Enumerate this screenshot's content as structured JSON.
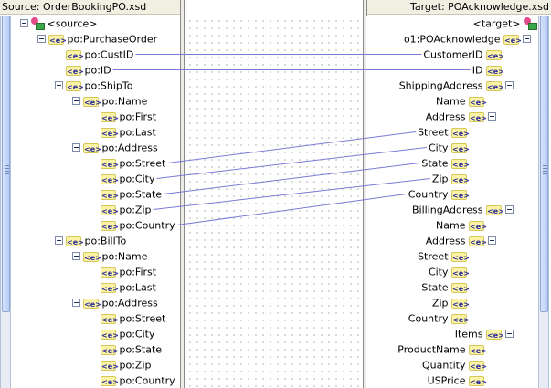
{
  "source_header": "Source: OrderBookingPO.xsd",
  "target_header": "Target: POAcknowledge.xsd",
  "icons": {
    "element": "element-icon",
    "root": "schema-root-icon",
    "expand": "collapse-toggle-icon"
  },
  "element_icon_glyph": "<e>",
  "source_tree": [
    {
      "label": "<source>",
      "level": 0,
      "root": true
    },
    {
      "label": "po:PurchaseOrder",
      "level": 1
    },
    {
      "label": "po:CustID",
      "level": 2
    },
    {
      "label": "po:ID",
      "level": 2
    },
    {
      "label": "po:ShipTo",
      "level": 2
    },
    {
      "label": "po:Name",
      "level": 3
    },
    {
      "label": "po:First",
      "level": 4
    },
    {
      "label": "po:Last",
      "level": 4
    },
    {
      "label": "po:Address",
      "level": 3
    },
    {
      "label": "po:Street",
      "level": 4
    },
    {
      "label": "po:City",
      "level": 4
    },
    {
      "label": "po:State",
      "level": 4
    },
    {
      "label": "po:Zip",
      "level": 4
    },
    {
      "label": "po:Country",
      "level": 4
    },
    {
      "label": "po:BillTo",
      "level": 2
    },
    {
      "label": "po:Name",
      "level": 3
    },
    {
      "label": "po:First",
      "level": 4
    },
    {
      "label": "po:Last",
      "level": 4
    },
    {
      "label": "po:Address",
      "level": 3
    },
    {
      "label": "po:Street",
      "level": 4
    },
    {
      "label": "po:City",
      "level": 4
    },
    {
      "label": "po:State",
      "level": 4
    },
    {
      "label": "po:Zip",
      "level": 4
    },
    {
      "label": "po:Country",
      "level": 4
    }
  ],
  "target_tree": [
    {
      "label": "<target>",
      "level": 0,
      "root": true
    },
    {
      "label": "o1:POAcknowledge",
      "level": 1
    },
    {
      "label": "CustomerID",
      "level": 2
    },
    {
      "label": "ID",
      "level": 2
    },
    {
      "label": "ShippingAddress",
      "level": 2
    },
    {
      "label": "Name",
      "level": 3
    },
    {
      "label": "Address",
      "level": 3
    },
    {
      "label": "Street",
      "level": 4
    },
    {
      "label": "City",
      "level": 4
    },
    {
      "label": "State",
      "level": 4
    },
    {
      "label": "Zip",
      "level": 4
    },
    {
      "label": "Country",
      "level": 4
    },
    {
      "label": "BillingAddress",
      "level": 2
    },
    {
      "label": "Name",
      "level": 3
    },
    {
      "label": "Address",
      "level": 3
    },
    {
      "label": "Street",
      "level": 4
    },
    {
      "label": "City",
      "level": 4
    },
    {
      "label": "State",
      "level": 4
    },
    {
      "label": "Zip",
      "level": 4
    },
    {
      "label": "Country",
      "level": 4
    },
    {
      "label": "Items",
      "level": 2
    },
    {
      "label": "ProductName",
      "level": 3
    },
    {
      "label": "Quantity",
      "level": 3
    },
    {
      "label": "USPrice",
      "level": 3
    }
  ],
  "mappings": [
    {
      "source": "po:CustID",
      "target": "CustomerID"
    },
    {
      "source": "po:ID",
      "target": "ID"
    },
    {
      "source": "po:Street",
      "target": "Street"
    },
    {
      "source": "po:City",
      "target": "City"
    },
    {
      "source": "po:State",
      "target": "State"
    },
    {
      "source": "po:Zip",
      "target": "Zip"
    },
    {
      "source": "po:Country",
      "target": "Country"
    }
  ],
  "colors": {
    "map_line": "#7a7ad6",
    "panel_header": "#f1efe2",
    "element_icon_bg": "#fbf3a5"
  }
}
